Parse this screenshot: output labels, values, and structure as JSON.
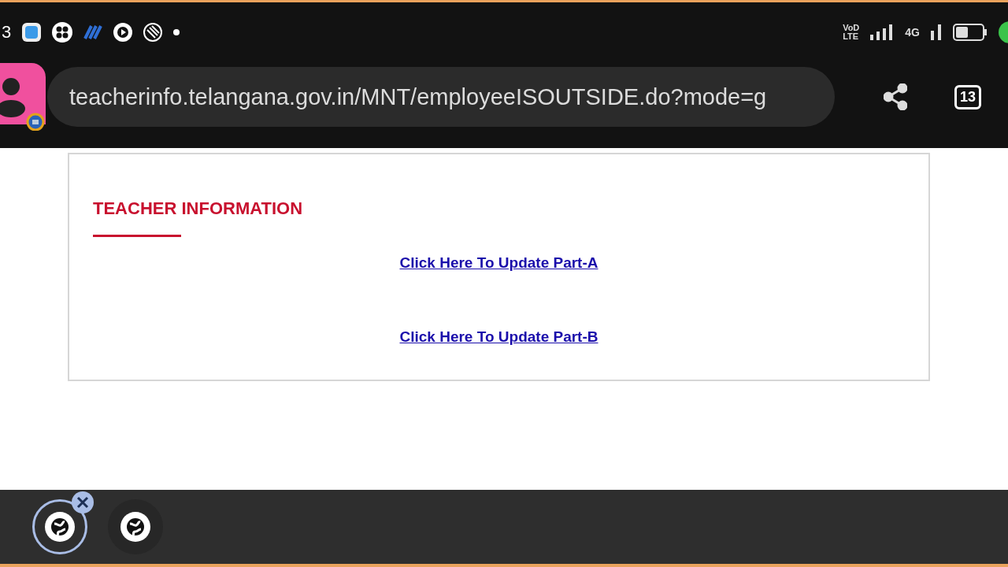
{
  "status_bar": {
    "time_fragment": "3",
    "network_labels": [
      "VoD",
      "LTE",
      "4G"
    ]
  },
  "address_bar": {
    "url": "teacherinfo.telangana.gov.in/MNT/employeeISOUTSIDE.do?mode=g",
    "tab_count": "13"
  },
  "page": {
    "heading": "TEACHER INFORMATION",
    "links": [
      "Click Here To Update Part-A",
      "Click Here To Update Part-B"
    ]
  },
  "bubbles": [
    {
      "selected": true
    },
    {
      "selected": false
    }
  ]
}
